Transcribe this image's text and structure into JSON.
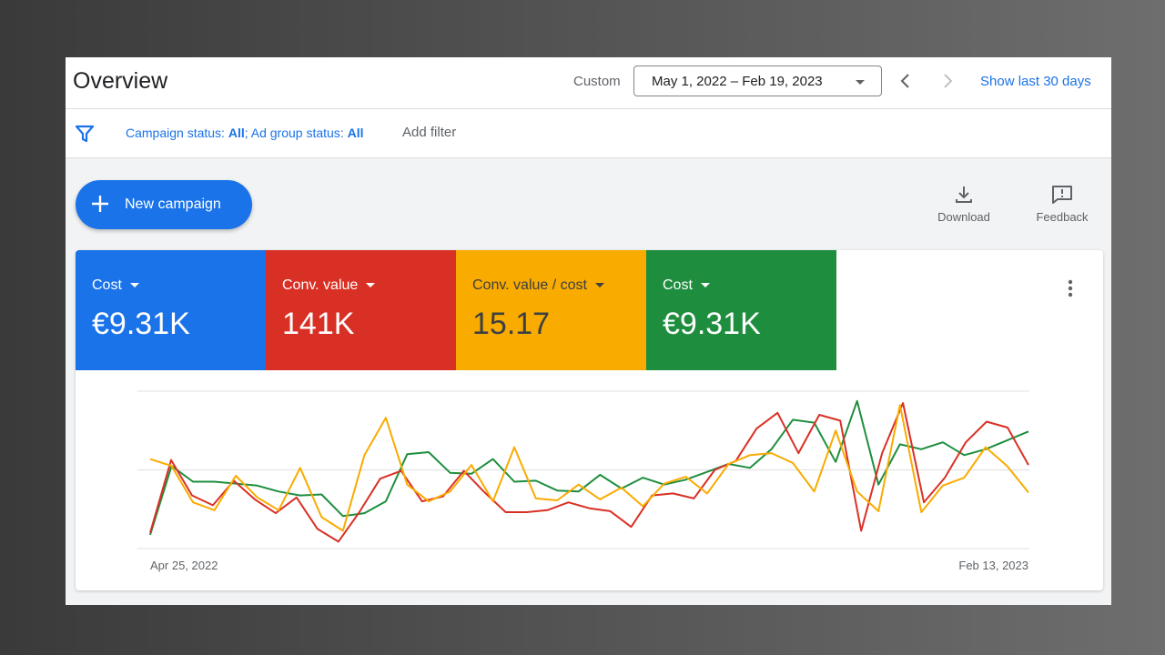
{
  "header": {
    "title": "Overview",
    "custom_label": "Custom",
    "date_range": "May 1, 2022 – Feb 19, 2023",
    "show_last": "Show last 30 days"
  },
  "filters": {
    "campaign_status_label": "Campaign status: ",
    "campaign_status_value": "All",
    "separator": "; ",
    "ad_group_status_label": "Ad group status: ",
    "ad_group_status_value": "All",
    "add_filter": "Add filter"
  },
  "toolbar": {
    "new_campaign": "New campaign",
    "download": "Download",
    "feedback": "Feedback"
  },
  "metrics": [
    {
      "label": "Cost",
      "value": "€9.31K",
      "color": "#1a73e8"
    },
    {
      "label": "Conv. value",
      "value": "141K",
      "color": "#d93025"
    },
    {
      "label": "Conv. value / cost",
      "value": "15.17",
      "color": "#f9ab00",
      "text_color": "#3c4043"
    },
    {
      "label": "Cost",
      "value": "€9.31K",
      "color": "#1e8e3e"
    }
  ],
  "chart_data": {
    "type": "line",
    "x_labels": [
      "Apr 25, 2022",
      "Feb 13, 2023"
    ],
    "grid": true,
    "series": [
      {
        "color": "#1e8e3e",
        "values": [
          14,
          84,
          68,
          68,
          66,
          64,
          58,
          54,
          55,
          33,
          36,
          48,
          96,
          98,
          77,
          76,
          91,
          68,
          69,
          59,
          58,
          75,
          61,
          72,
          65,
          70,
          78,
          86,
          82,
          101,
          131,
          128,
          88,
          150,
          65,
          106,
          101,
          108,
          95,
          101,
          110,
          119
        ]
      },
      {
        "color": "#d93025",
        "values": [
          16,
          90,
          54,
          44,
          69,
          50,
          36,
          52,
          20,
          7,
          37,
          71,
          79,
          48,
          53,
          79,
          57,
          37,
          37,
          39,
          47,
          41,
          38,
          22,
          54,
          56,
          51,
          80,
          89,
          122,
          138,
          97,
          136,
          130,
          18,
          97,
          148,
          47,
          72,
          108,
          129,
          123,
          85
        ]
      },
      {
        "color": "#f9ab00",
        "values": [
          91,
          84,
          47,
          39,
          74,
          52,
          39,
          82,
          32,
          18,
          95,
          133,
          65,
          48,
          58,
          85,
          48,
          103,
          51,
          49,
          65,
          50,
          62,
          43,
          66,
          73,
          56,
          86,
          95,
          97,
          87,
          58,
          120,
          58,
          38,
          146,
          37,
          64,
          72,
          103,
          84,
          57
        ]
      }
    ]
  }
}
